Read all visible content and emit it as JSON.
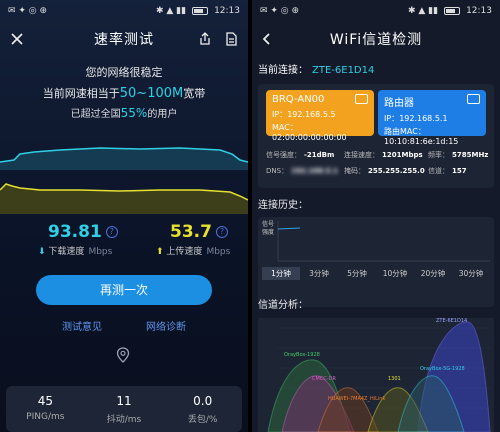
{
  "status": {
    "time": "12:13"
  },
  "left": {
    "title": "速率测试",
    "msg1": "您的网络很稳定",
    "msg2_pre": "当前网速相当于",
    "msg2_hl": "50~100M",
    "msg2_post": "宽带",
    "msg3_pre": "已超过全国",
    "msg3_hl": "55%",
    "msg3_post": "的用户",
    "download": {
      "value": "93.81",
      "label": "下载速度",
      "unit": "Mbps",
      "color": "#2fd0e6"
    },
    "upload": {
      "value": "53.7",
      "label": "上传速度",
      "unit": "Mbps",
      "color": "#e6e02f"
    },
    "retest_button": "再测一次",
    "link_feedback": "测试意见",
    "link_diagnose": "网络诊断",
    "stats": [
      {
        "value": "45",
        "label": "PING/ms"
      },
      {
        "value": "11",
        "label": "抖动/ms"
      },
      {
        "value": "0.0",
        "label": "丢包/%"
      }
    ]
  },
  "right": {
    "title": "WiFi信道检测",
    "current_label": "当前连接：",
    "current_ssid": "ZTE-6E1D14",
    "ap1": {
      "name": "BRQ-AN00",
      "ip_label": "IP：",
      "ip": "192.168.5.5",
      "mac_label": "MAC：",
      "mac": "02:00:00:00:00:00",
      "color": "#f2a21e"
    },
    "ap2": {
      "name": "路由器",
      "ip_label": "IP：",
      "ip": "192.168.5.1",
      "mac_label": "路由MAC：",
      "mac": "10:10:81:6e:1d:15",
      "color": "#1e7ee6"
    },
    "info": {
      "signal_label": "信号强度：",
      "signal": "-21dBm",
      "speed_label": "连接速度：",
      "speed": "1201Mbps",
      "freq_label": "频率：",
      "freq": "5785MHz",
      "dns_label": "DNS：",
      "dns": "192.168.5.1",
      "mask_label": "掩码：",
      "mask": "255.255.255.0",
      "channel_label": "信道：",
      "channel": "157"
    },
    "history_label": "连接历史：",
    "history_axis": "信号强度",
    "tabs": [
      "1分钟",
      "3分钟",
      "5分钟",
      "10分钟",
      "20分钟",
      "30分钟"
    ],
    "analysis_label": "信道分析：",
    "networks": [
      "ZTE-6E1D14",
      "OrayBox-1928",
      "CMCC-DR",
      "OrayBox-5G-1928",
      "1301",
      "HUAWEI-7MA4Z_HiLink"
    ]
  }
}
